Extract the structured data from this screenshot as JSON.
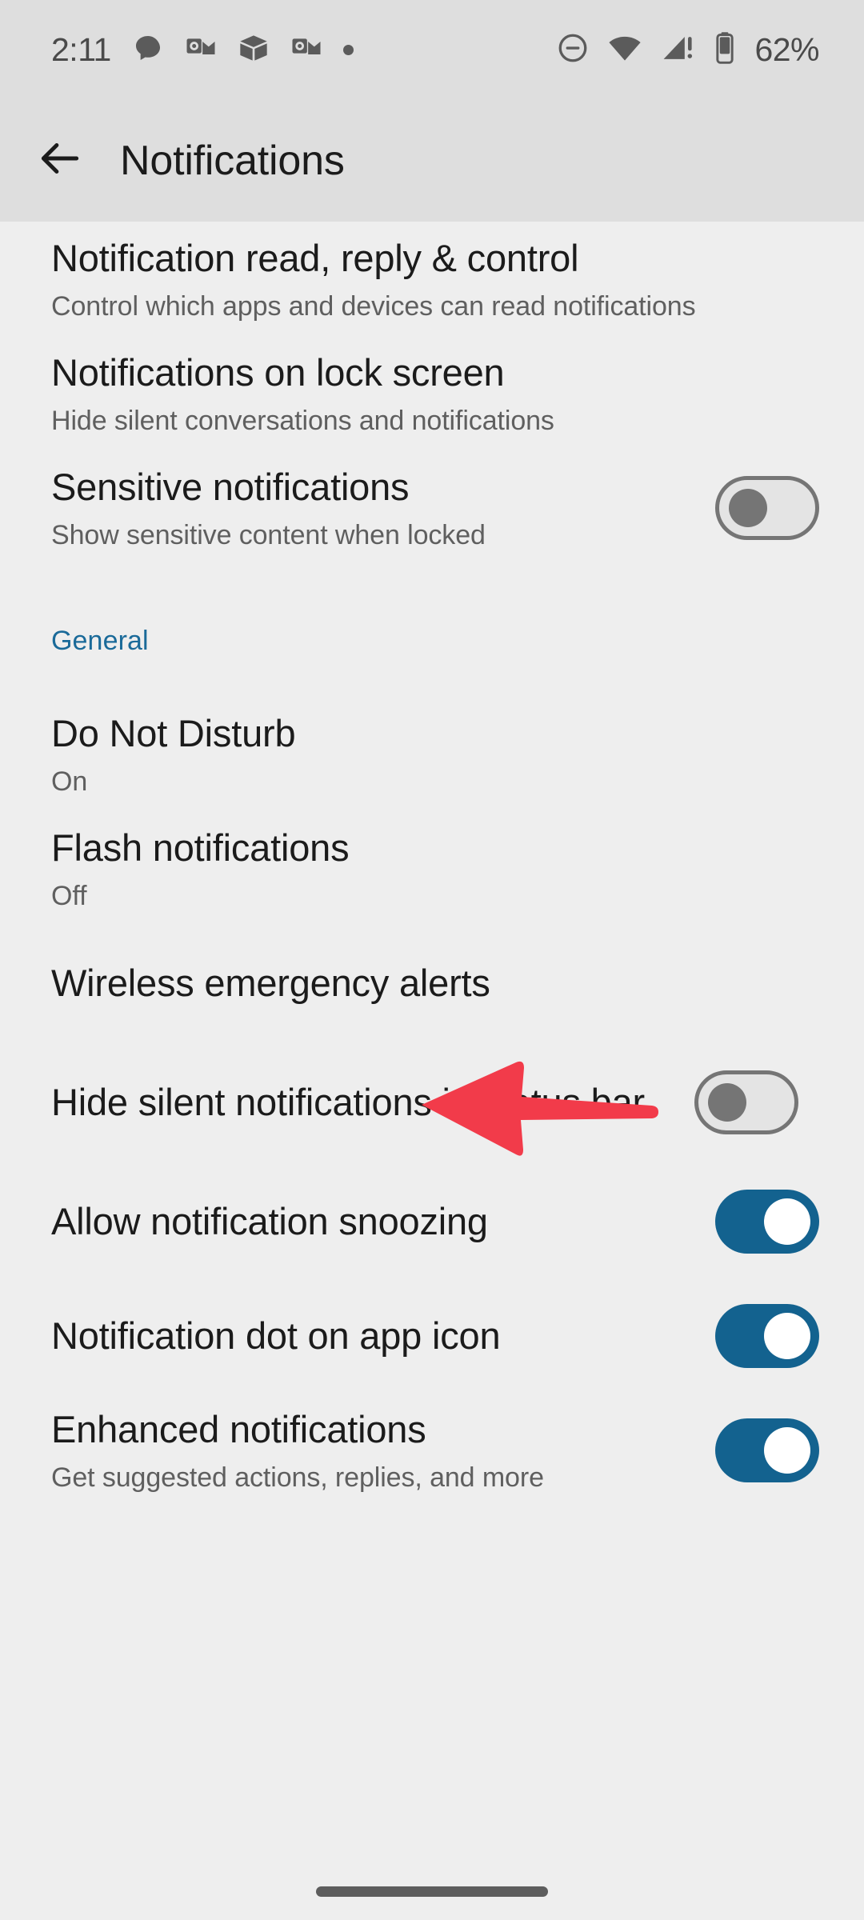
{
  "status_bar": {
    "time": "2:11",
    "battery_percent": "62%",
    "left_icons": [
      "chat-bubble-icon",
      "outlook-icon",
      "package-box-icon",
      "outlook-icon",
      "dot-icon"
    ],
    "right_icons": [
      "do-not-disturb-icon",
      "wifi-icon",
      "cellular-signal-warning-icon",
      "battery-icon"
    ]
  },
  "app_bar": {
    "back_icon": "back-arrow-icon",
    "title": "Notifications"
  },
  "colors": {
    "accent_blue": "#1a6a99",
    "toggle_on": "#13628f",
    "toggle_off_track": "#e4e4e4",
    "toggle_off_border": "#757575",
    "annotation_red": "#f23b4a",
    "appbar_bg": "#dedede",
    "content_bg": "#eeeeee"
  },
  "annotation": {
    "type": "arrow",
    "points_to": "Flash notifications",
    "direction": "left",
    "color": "#f23b4a"
  },
  "sections": [
    {
      "header": null,
      "items": [
        {
          "title": "Notification read, reply & control",
          "subtitle": "Control which apps and devices can read notifications",
          "control": "none"
        },
        {
          "title": "Notifications on lock screen",
          "subtitle": "Hide silent conversations and notifications",
          "control": "none"
        },
        {
          "title": "Sensitive notifications",
          "subtitle": "Show sensitive content when locked",
          "control": "toggle",
          "toggle_state": "off"
        }
      ]
    },
    {
      "header": "General",
      "items": [
        {
          "title": "Do Not Disturb",
          "subtitle": "On",
          "control": "none"
        },
        {
          "title": "Flash notifications",
          "subtitle": "Off",
          "control": "none"
        },
        {
          "title": "Wireless emergency alerts",
          "subtitle": null,
          "control": "none"
        },
        {
          "title": "Hide silent notifications in status bar",
          "subtitle": null,
          "control": "toggle",
          "toggle_state": "off"
        },
        {
          "title": "Allow notification snoozing",
          "subtitle": null,
          "control": "toggle",
          "toggle_state": "on"
        },
        {
          "title": "Notification dot on app icon",
          "subtitle": null,
          "control": "toggle",
          "toggle_state": "on"
        },
        {
          "title": "Enhanced notifications",
          "subtitle": "Get suggested actions, replies, and more",
          "control": "toggle",
          "toggle_state": "on"
        }
      ]
    }
  ]
}
